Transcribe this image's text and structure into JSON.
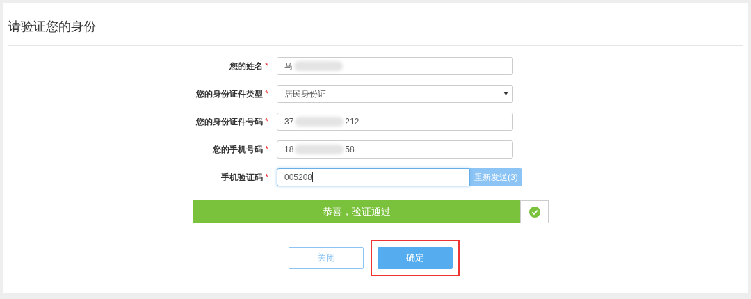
{
  "title": "请验证您的身份",
  "fields": [
    {
      "label": "您的姓名",
      "required_mark": "*",
      "kind": "text",
      "value_start": "马",
      "redacted": true
    },
    {
      "label": "您的身份证件类型",
      "required_mark": "*",
      "kind": "select",
      "value_start": "居民身份证"
    },
    {
      "label": "您的身份证件号码",
      "required_mark": "*",
      "kind": "text",
      "value_start": "37",
      "value_end": "212",
      "redacted": true
    },
    {
      "label": "您的手机号码",
      "required_mark": "*",
      "kind": "text",
      "value_start": "18",
      "value_end": "58",
      "redacted": true
    },
    {
      "label": "手机验证码",
      "required_mark": "*",
      "kind": "code",
      "value_start": "005208",
      "focused": true,
      "button": "重新发送(3)"
    }
  ],
  "result": {
    "message": "恭喜，验证通过",
    "success": true
  },
  "buttons": [
    {
      "label": "关闭",
      "kind": "outline",
      "highlighted": false
    },
    {
      "label": "确定",
      "kind": "primary",
      "highlighted": true
    }
  ]
}
